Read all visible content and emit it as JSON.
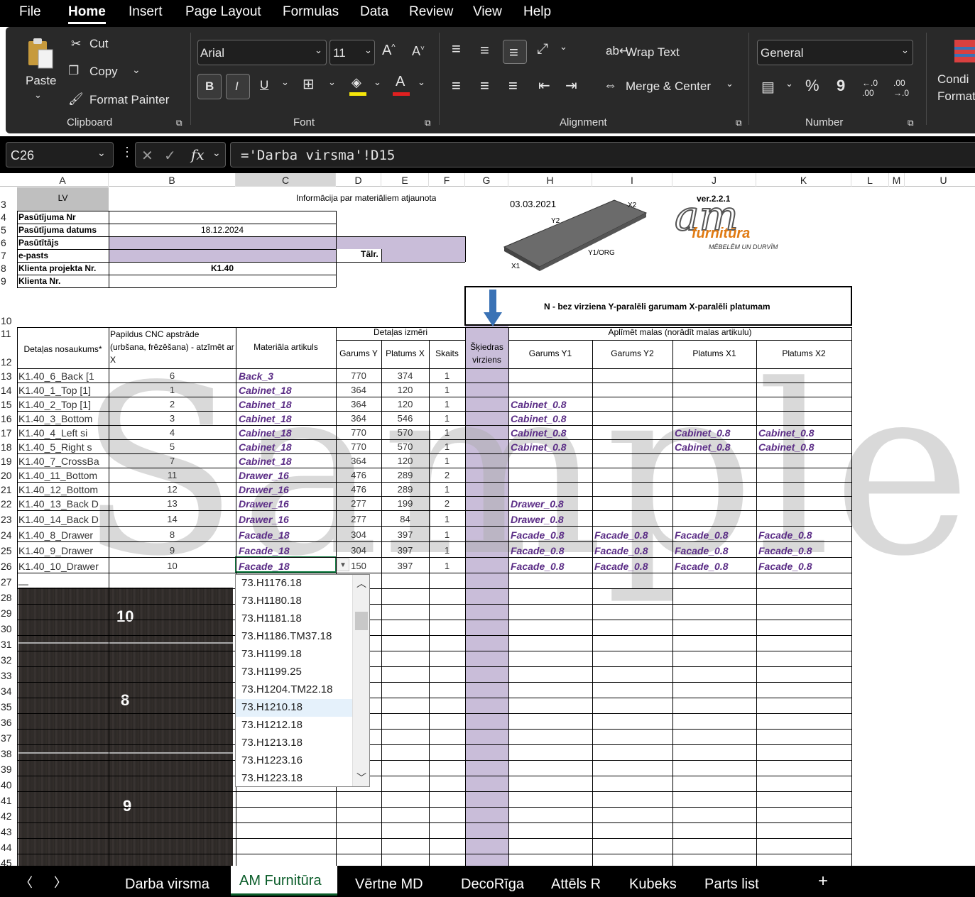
{
  "menu": [
    "File",
    "Home",
    "Insert",
    "Page Layout",
    "Formulas",
    "Data",
    "Review",
    "View",
    "Help"
  ],
  "ribbon": {
    "clipboard": {
      "paste": "Paste",
      "cut": "Cut",
      "copy": "Copy",
      "format_painter": "Format Painter",
      "label": "Clipboard"
    },
    "font": {
      "name": "Arial",
      "size": "11",
      "label": "Font",
      "bold": "B",
      "italic": "I",
      "underline": "U",
      "grow": "A^",
      "shrink": "A˅"
    },
    "alignment": {
      "wrap": "Wrap Text",
      "merge": "Merge & Center",
      "label": "Alignment"
    },
    "number": {
      "format": "General",
      "percent": "%",
      "comma": "9",
      "inc": ".0→.00",
      "dec": ".00→.0",
      "label": "Number"
    },
    "styles": {
      "cond": "Condi",
      "cond2": "Formatt"
    }
  },
  "formula_bar": {
    "name_box": "C26",
    "fx": "fx",
    "formula": "='Darba virsma'!D15"
  },
  "columns": [
    "A",
    "B",
    "C",
    "D",
    "E",
    "F",
    "G",
    "H",
    "I",
    "J",
    "K",
    "L",
    "M",
    "U"
  ],
  "rows": [
    "3",
    "4",
    "5",
    "6",
    "7",
    "8",
    "9",
    "10",
    "11",
    "12",
    "13",
    "14",
    "15",
    "16",
    "17",
    "18",
    "19",
    "20",
    "21",
    "22",
    "23",
    "24",
    "25",
    "26",
    "27",
    "28",
    "29",
    "30",
    "31",
    "32",
    "33",
    "34",
    "35",
    "36",
    "37",
    "38",
    "39",
    "40",
    "41",
    "42",
    "43",
    "44",
    "45"
  ],
  "sheet": {
    "lv": "LV",
    "info": "Informācija par materiāliem atjaunota",
    "date": "03.03.2021",
    "version": "ver.2.2.1",
    "logo_main": "am",
    "logo_sub": "furnitūra",
    "logo_tag": "MĒBELĒM UN DURVĪM",
    "board_labels": {
      "x2": "X2",
      "y2": "Y2",
      "y1": "Y1/ORG",
      "x1": "X1"
    },
    "form": [
      {
        "label": "Pasūtījuma Nr",
        "value": ""
      },
      {
        "label": "Pasūtījuma datums",
        "value": "18.12.2024"
      },
      {
        "label": "Pasūtītājs",
        "value": ""
      },
      {
        "label": "e-pasts",
        "value": ""
      },
      {
        "label": "Klienta projekta Nr.",
        "value": "K1.40"
      },
      {
        "label": "Klienta Nr.",
        "value": ""
      }
    ],
    "talr": "Tālr.",
    "legend": "N - bez virziena  Y-paralēli garumam  X-paralēli platumam",
    "headers": {
      "name": "Detaļas nosaukums*",
      "cnc": "Papildus CNC apstrāde (urbšana, frēzēšana) - atzīmēt ar X",
      "material": "Materiāla artikuls",
      "dims": "Detaļas izmēri",
      "gy": "Garums Y",
      "px": "Platums X",
      "qty": "Skaits",
      "grain": "Šķiedras virziens",
      "edges": "Aplīmēt malas (norādīt malas artikulu)",
      "ey1": "Garums Y1",
      "ey2": "Garums Y2",
      "ex1": "Platums X1",
      "ex2": "Platums X2"
    },
    "data_rows": [
      [
        "K1.40_6_Back [1",
        "6",
        "Back_3",
        "770",
        "374",
        "1",
        "",
        "",
        "",
        ""
      ],
      [
        "K1.40_1_Top [1]",
        "1",
        "Cabinet_18",
        "364",
        "120",
        "1",
        "",
        "",
        "",
        ""
      ],
      [
        "K1.40_2_Top [1]",
        "2",
        "Cabinet_18",
        "364",
        "120",
        "1",
        "Cabinet_0.8",
        "",
        "",
        ""
      ],
      [
        "K1.40_3_Bottom",
        "3",
        "Cabinet_18",
        "364",
        "546",
        "1",
        "Cabinet_0.8",
        "",
        "",
        ""
      ],
      [
        "K1.40_4_Left si",
        "4",
        "Cabinet_18",
        "770",
        "570",
        "1",
        "Cabinet_0.8",
        "",
        "Cabinet_0.8",
        "Cabinet_0.8"
      ],
      [
        "K1.40_5_Right s",
        "5",
        "Cabinet_18",
        "770",
        "570",
        "1",
        "Cabinet_0.8",
        "",
        "Cabinet_0.8",
        "Cabinet_0.8"
      ],
      [
        "K1.40_7_CrossBa",
        "7",
        "Cabinet_18",
        "364",
        "120",
        "1",
        "",
        "",
        "",
        ""
      ],
      [
        "K1.40_11_Bottom",
        "11",
        "Drawer_16",
        "476",
        "289",
        "2",
        "",
        "",
        "",
        ""
      ],
      [
        "K1.40_12_Bottom",
        "12",
        "Drawer_16",
        "476",
        "289",
        "1",
        "",
        "",
        "",
        ""
      ],
      [
        "K1.40_13_Back D",
        "13",
        "Drawer_16",
        "277",
        "199",
        "2",
        "Drawer_0.8",
        "",
        "",
        ""
      ],
      [
        "K1.40_14_Back D",
        "14",
        "Drawer_16",
        "277",
        "84",
        "1",
        "Drawer_0.8",
        "",
        "",
        ""
      ],
      [
        "K1.40_8_Drawer",
        "8",
        "Facade_18",
        "304",
        "397",
        "1",
        "Facade_0.8",
        "Facade_0.8",
        "Facade_0.8",
        "Facade_0.8"
      ],
      [
        "K1.40_9_Drawer",
        "9",
        "Facade_18",
        "304",
        "397",
        "1",
        "Facade_0.8",
        "Facade_0.8",
        "Facade_0.8",
        "Facade_0.8"
      ],
      [
        "K1.40_10_Drawer",
        "10",
        "Facade_18",
        "150",
        "397",
        "1",
        "Facade_0.8",
        "Facade_0.8",
        "Facade_0.8",
        "Facade_0.8"
      ]
    ],
    "row27": "__",
    "preview_labels": [
      "10",
      "8",
      "9"
    ],
    "watermark": "Sample"
  },
  "dropdown": [
    "73.H1176.18",
    "73.H1180.18",
    "73.H1181.18",
    "73.H1186.TM37.18",
    "73.H1199.18",
    "73.H1199.25",
    "73.H1204.TM22.18",
    "73.H1210.18",
    "73.H1212.18",
    "73.H1213.18",
    "73.H1223.16",
    "73.H1223.18"
  ],
  "tabs": [
    "Darba virsma",
    "AM Furnitūra",
    "Vērtne  MD",
    "DecoRīga",
    "Attēls R",
    "Kubeks",
    "Parts list"
  ],
  "colors": {
    "lilac": "#c9bdd9",
    "material": "#5b2d86",
    "arrow": "#3a72b5"
  }
}
